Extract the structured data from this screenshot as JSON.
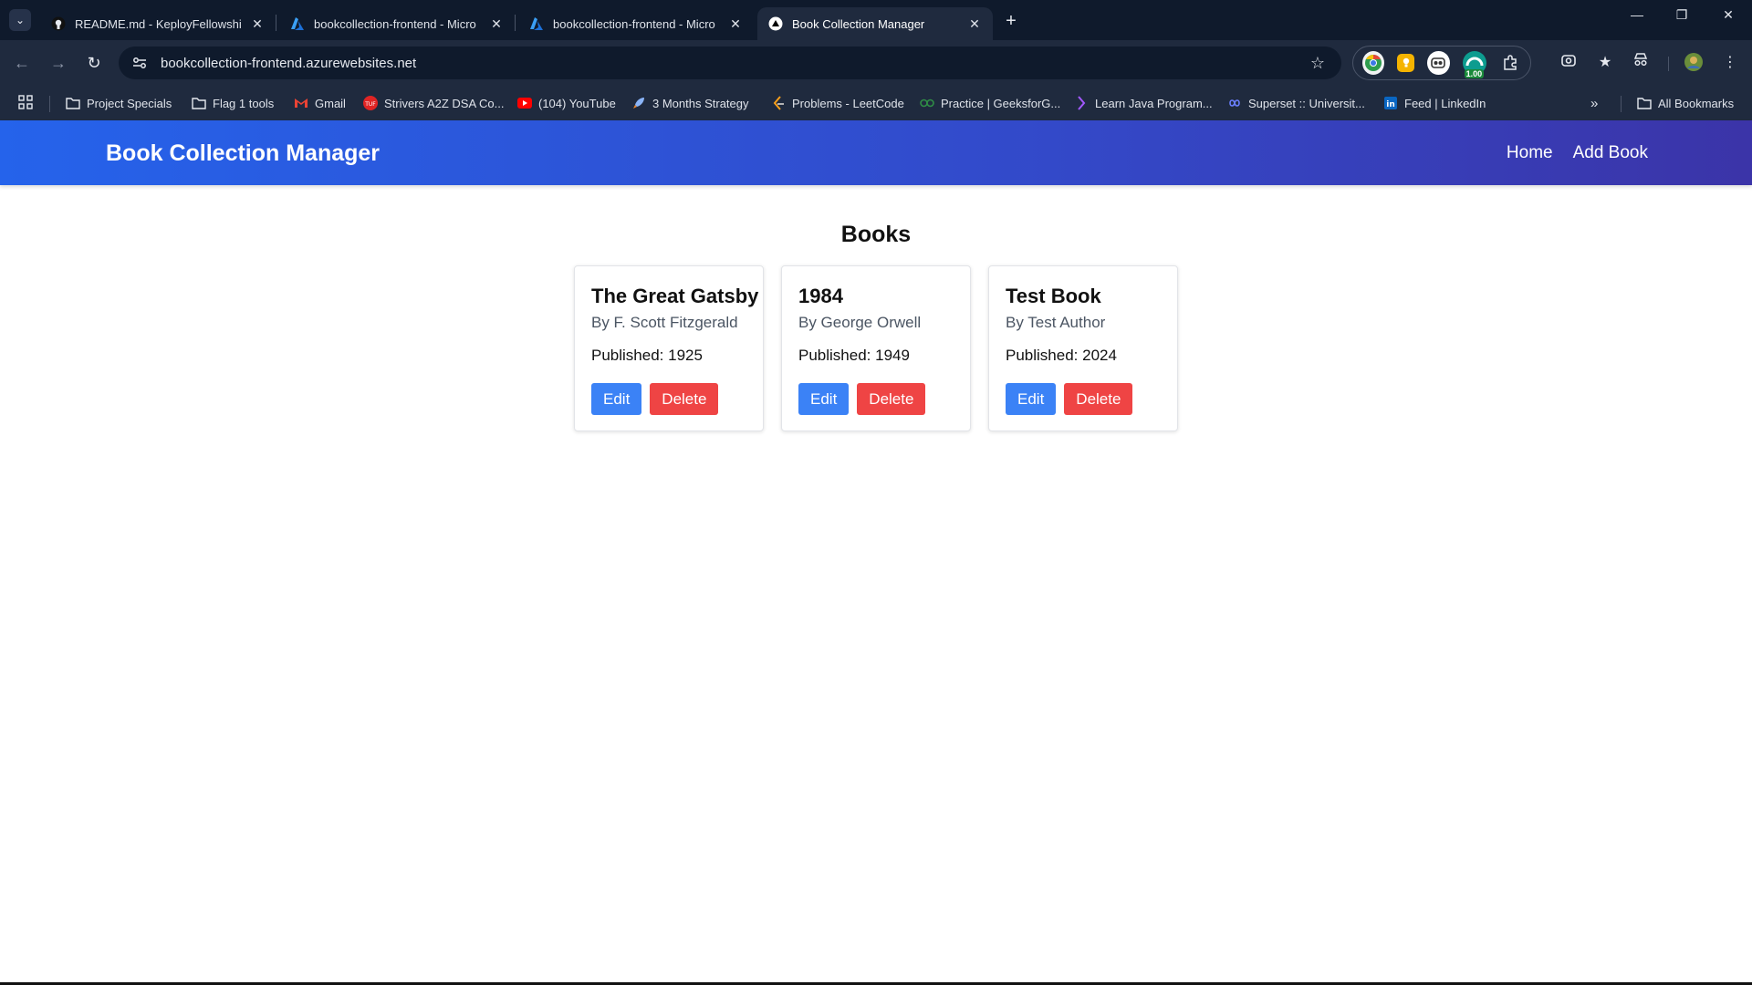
{
  "browser": {
    "tabs": [
      {
        "title": "README.md - KeployFellowship",
        "icon": "github-icon",
        "active": false
      },
      {
        "title": "bookcollection-frontend - Micro",
        "icon": "azure-icon",
        "active": false
      },
      {
        "title": "bookcollection-frontend - Micro",
        "icon": "azure-icon",
        "active": false
      },
      {
        "title": "Book Collection Manager",
        "icon": "vercel-icon",
        "active": true
      }
    ],
    "url": "bookcollection-frontend.azurewebsites.net",
    "extension_badge": "1.00",
    "bookmarks": [
      {
        "label": "Project Specials",
        "icon": "folder-icon"
      },
      {
        "label": "Flag 1 tools",
        "icon": "folder-icon"
      },
      {
        "label": "Gmail",
        "icon": "gmail-icon"
      },
      {
        "label": "Strivers A2Z DSA Co...",
        "icon": "tuf-icon"
      },
      {
        "label": "(104) YouTube",
        "icon": "youtube-icon"
      },
      {
        "label": "3 Months Strategy",
        "icon": "rocket-icon"
      },
      {
        "label": "Problems - LeetCode",
        "icon": "leetcode-icon"
      },
      {
        "label": "Practice | GeeksforG...",
        "icon": "gfg-icon"
      },
      {
        "label": "Learn Java Program...",
        "icon": "java-icon"
      },
      {
        "label": "Superset :: Universit...",
        "icon": "superset-icon"
      },
      {
        "label": "Feed | LinkedIn",
        "icon": "linkedin-icon"
      }
    ],
    "all_bookmarks": "All Bookmarks"
  },
  "app": {
    "title": "Book Collection Manager",
    "nav": {
      "home": "Home",
      "add_book": "Add Book"
    },
    "heading": "Books",
    "books": [
      {
        "title": "The Great Gatsby",
        "author": "By F. Scott Fitzgerald",
        "published": "Published: 1925",
        "edit": "Edit",
        "delete": "Delete"
      },
      {
        "title": "1984",
        "author": "By George Orwell",
        "published": "Published: 1949",
        "edit": "Edit",
        "delete": "Delete"
      },
      {
        "title": "Test Book",
        "author": "By Test Author",
        "published": "Published: 2024",
        "edit": "Edit",
        "delete": "Delete"
      }
    ]
  },
  "colors": {
    "header_start": "#2563eb",
    "header_end": "#3b34a8",
    "edit_button": "#3b82f6",
    "delete_button": "#ef4444"
  }
}
